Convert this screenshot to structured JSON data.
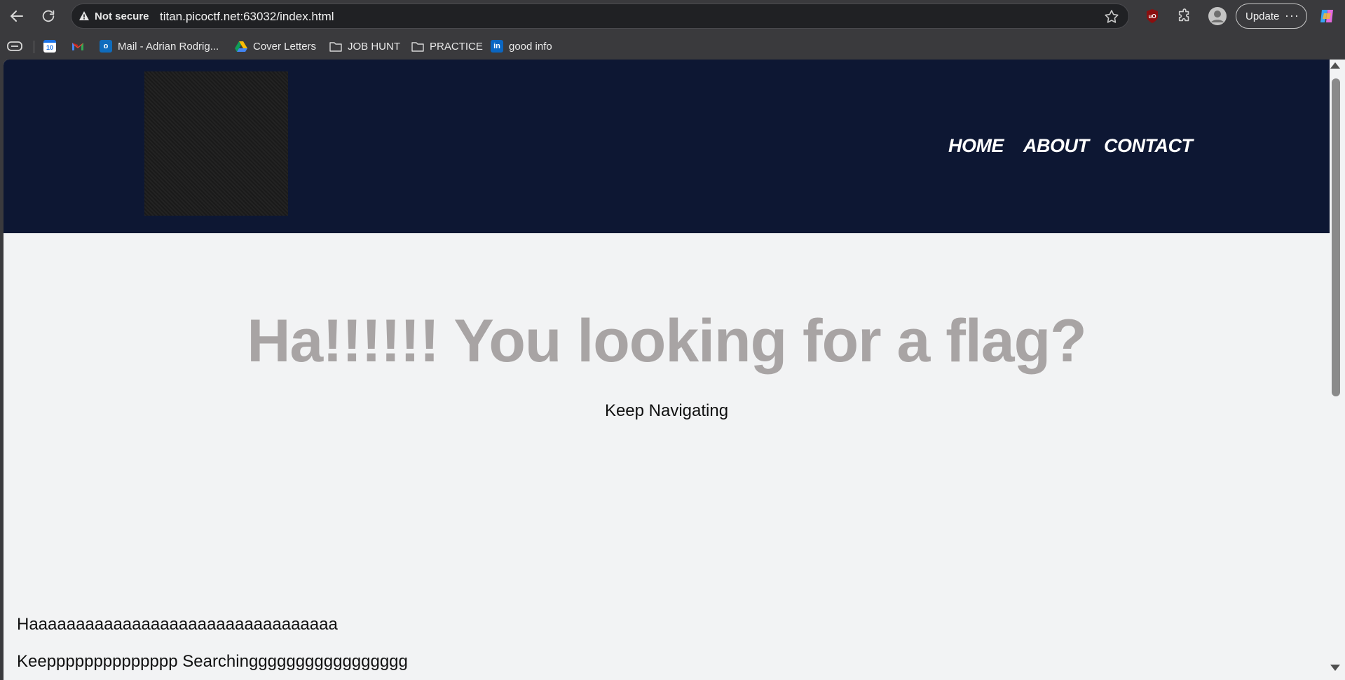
{
  "browser": {
    "address": {
      "security_label": "Not secure",
      "url": "titan.picoctf.net:63032/index.html"
    },
    "update_label": "Update",
    "more_label": "···",
    "bookmarks": [
      {
        "label": "",
        "icon": "calendar-icon"
      },
      {
        "label": "",
        "icon": "gmail-icon"
      },
      {
        "label": "Mail - Adrian Rodrig...",
        "icon": "outlook-icon"
      },
      {
        "label": "Cover Letters",
        "icon": "drive-icon"
      },
      {
        "label": "JOB HUNT",
        "icon": "folder-icon"
      },
      {
        "label": "PRACTICE",
        "icon": "folder-icon"
      },
      {
        "label": "good info",
        "icon": "linkedin-icon"
      }
    ],
    "calendar_day": "10"
  },
  "site": {
    "nav": [
      "HOME",
      "ABOUT",
      "CONTACT"
    ],
    "hero_title": "Ha!!!!!! You looking for a flag?",
    "hero_subtitle": "Keep Navigating",
    "paragraphs": [
      "Haaaaaaaaaaaaaaaaaaaaaaaaaaaaaaaaa",
      "Keepppppppppppppp Searchinggggggggggggggggg"
    ]
  },
  "colors": {
    "header_bg": "#0d1733",
    "page_bg": "#f2f3f4",
    "hero_title": "#a8a4a4"
  }
}
